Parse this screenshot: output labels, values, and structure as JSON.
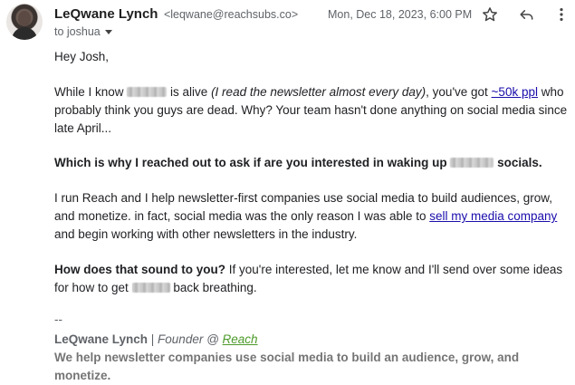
{
  "header": {
    "sender_name": "LeQwane Lynch",
    "sender_email": "<leqwane@reachsubs.co>",
    "to_line": "to joshua",
    "date": "Mon, Dec 18, 2023, 6:00 PM",
    "icons": [
      "star-icon",
      "reply-icon",
      "more-vert-icon"
    ]
  },
  "body": {
    "greeting": "Hey Josh,",
    "p1_a": "While I know ",
    "p1_b": " is alive ",
    "p1_italic": "(I read the newsletter almost every day)",
    "p1_c": ",  you've got ",
    "p1_link": "~50k ppl",
    "p1_d": " who probably think you guys are dead. Why? Your team hasn't done anything on social media since late April...",
    "p2_a": "Which is why I reached out to ask if are you interested in waking up ",
    "p2_b": " socials.",
    "p3_a": "I run Reach and I help newsletter-first companies use social media to build audiences, grow, and monetize. in fact, social media was the only reason I was able to ",
    "p3_link": "sell my media company",
    "p3_b": " and begin working with other newsletters in the industry.",
    "p4_bold": "How does that sound to you?",
    "p4_a": " If you're interested, let me know and I'll send over some ideas for how to get ",
    "p4_b": " back breathing."
  },
  "signature": {
    "dashes": "--",
    "name": "LeQwane Lynch",
    "sep": " | ",
    "role": "Founder @ ",
    "company_link": "Reach",
    "tagline": "We help newsletter companies use social media to build an audience, grow, and monetize."
  }
}
